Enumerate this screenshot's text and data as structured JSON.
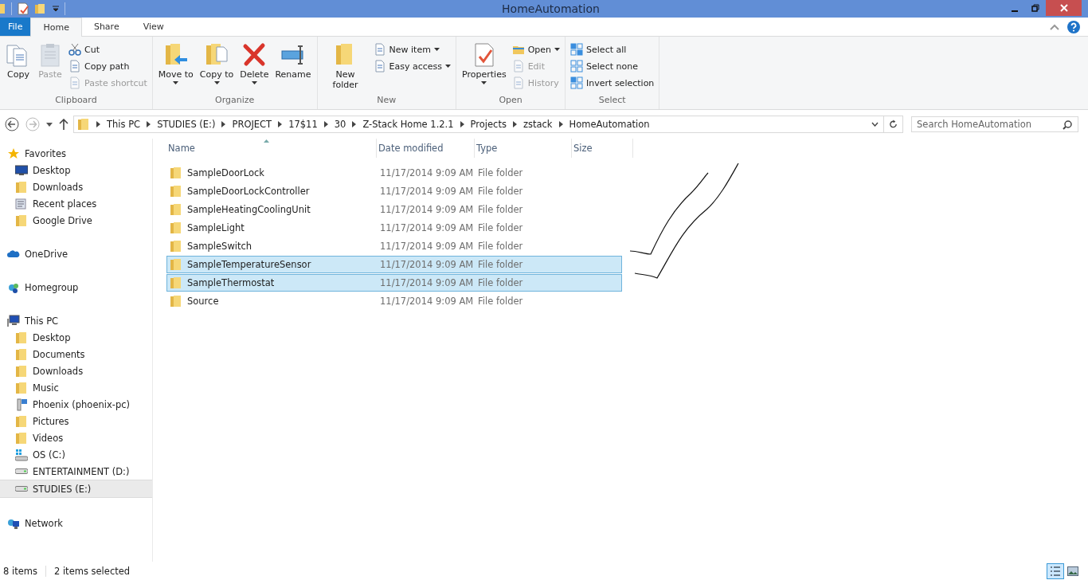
{
  "window": {
    "title": "HomeAutomation"
  },
  "tabs": [
    {
      "label": "File",
      "kind": "file",
      "selected": false
    },
    {
      "label": "Home",
      "kind": "tab",
      "selected": true
    },
    {
      "label": "Share",
      "kind": "tab",
      "selected": false
    },
    {
      "label": "View",
      "kind": "tab",
      "selected": false
    }
  ],
  "ribbon": [
    {
      "label": "Clipboard",
      "buttons": [
        {
          "label": "Copy",
          "kind": "large",
          "disabled": false,
          "dropdown": false
        },
        {
          "label": "Paste",
          "kind": "large",
          "disabled": true,
          "dropdown": false
        },
        {
          "kind": "stack",
          "items": [
            {
              "label": "Cut",
              "disabled": false,
              "dropdown": false
            },
            {
              "label": "Copy path",
              "disabled": false,
              "dropdown": false
            },
            {
              "label": "Paste shortcut",
              "disabled": true,
              "dropdown": false
            }
          ]
        }
      ]
    },
    {
      "label": "Organize",
      "buttons": [
        {
          "label": "Move to",
          "kind": "large",
          "disabled": false,
          "dropdown": true
        },
        {
          "label": "Copy to",
          "kind": "large",
          "disabled": false,
          "dropdown": true
        },
        {
          "label": "Delete",
          "kind": "large",
          "disabled": false,
          "dropdown": true
        },
        {
          "label": "Rename",
          "kind": "large",
          "disabled": false,
          "dropdown": false
        }
      ]
    },
    {
      "label": "New",
      "buttons": [
        {
          "label": "New folder",
          "kind": "large",
          "disabled": false,
          "dropdown": false
        },
        {
          "kind": "stack",
          "items": [
            {
              "label": "New item",
              "disabled": false,
              "dropdown": true
            },
            {
              "label": "Easy access",
              "disabled": false,
              "dropdown": true
            }
          ]
        }
      ]
    },
    {
      "label": "Open",
      "buttons": [
        {
          "label": "Properties",
          "kind": "large",
          "disabled": false,
          "dropdown": true
        },
        {
          "kind": "stack",
          "items": [
            {
              "label": "Open",
              "disabled": false,
              "dropdown": true
            },
            {
              "label": "Edit",
              "disabled": true,
              "dropdown": false
            },
            {
              "label": "History",
              "disabled": true,
              "dropdown": false
            }
          ]
        }
      ]
    },
    {
      "label": "Select",
      "buttons": [
        {
          "kind": "stack",
          "items": [
            {
              "label": "Select all",
              "disabled": false,
              "dropdown": false
            },
            {
              "label": "Select none",
              "disabled": false,
              "dropdown": false
            },
            {
              "label": "Invert selection",
              "disabled": false,
              "dropdown": false
            }
          ]
        }
      ]
    }
  ],
  "address": {
    "path": [
      "This PC",
      "STUDIES (E:)",
      "PROJECT",
      "17$11",
      "30",
      "Z-Stack Home 1.2.1",
      "Projects",
      "zstack",
      "HomeAutomation"
    ]
  },
  "search": {
    "placeholder": "Search HomeAutomation"
  },
  "sidebar": [
    {
      "label": "Favorites",
      "kind": "star",
      "selected": false,
      "children": [
        {
          "label": "Desktop",
          "kind": "desktop",
          "selected": false
        },
        {
          "label": "Downloads",
          "kind": "folder",
          "selected": false
        },
        {
          "label": "Recent places",
          "kind": "recent",
          "selected": false
        },
        {
          "label": "Google Drive",
          "kind": "folder",
          "selected": false
        }
      ]
    },
    {
      "label": "OneDrive",
      "kind": "cloud",
      "selected": false
    },
    {
      "label": "Homegroup",
      "kind": "homegroup",
      "selected": false
    },
    {
      "label": "This PC",
      "kind": "computer",
      "selected": false,
      "children": [
        {
          "label": "Desktop",
          "kind": "folder",
          "selected": false
        },
        {
          "label": "Documents",
          "kind": "folder",
          "selected": false
        },
        {
          "label": "Downloads",
          "kind": "folder",
          "selected": false
        },
        {
          "label": "Music",
          "kind": "folder",
          "selected": false
        },
        {
          "label": "Phoenix (phoenix-pc)",
          "kind": "pc",
          "selected": false
        },
        {
          "label": "Pictures",
          "kind": "folder",
          "selected": false
        },
        {
          "label": "Videos",
          "kind": "folder",
          "selected": false
        },
        {
          "label": "OS (C:)",
          "kind": "windrive",
          "selected": false
        },
        {
          "label": "ENTERTAINMENT (D:)",
          "kind": "drive",
          "selected": false
        },
        {
          "label": "STUDIES (E:)",
          "kind": "drive",
          "selected": true
        }
      ]
    },
    {
      "label": "Network",
      "kind": "network",
      "selected": false
    }
  ],
  "columns": [
    "Name",
    "Date modified",
    "Type",
    "Size"
  ],
  "files": [
    {
      "name": "SampleDoorLock",
      "date": "11/17/2014 9:09 AM",
      "type": "File folder",
      "selected": false
    },
    {
      "name": "SampleDoorLockController",
      "date": "11/17/2014 9:09 AM",
      "type": "File folder",
      "selected": false
    },
    {
      "name": "SampleHeatingCoolingUnit",
      "date": "11/17/2014 9:09 AM",
      "type": "File folder",
      "selected": false
    },
    {
      "name": "SampleLight",
      "date": "11/17/2014 9:09 AM",
      "type": "File folder",
      "selected": false
    },
    {
      "name": "SampleSwitch",
      "date": "11/17/2014 9:09 AM",
      "type": "File folder",
      "selected": false
    },
    {
      "name": "SampleTemperatureSensor",
      "date": "11/17/2014 9:09 AM",
      "type": "File folder",
      "selected": true
    },
    {
      "name": "SampleThermostat",
      "date": "11/17/2014 9:09 AM",
      "type": "File folder",
      "selected": true
    },
    {
      "name": "Source",
      "date": "11/17/2014 9:09 AM",
      "type": "File folder",
      "selected": false
    }
  ],
  "status_bar": {
    "count": "8 items",
    "selection": "2 items selected"
  },
  "views": [
    {
      "kind": "details",
      "selected": true
    },
    {
      "kind": "large-icons",
      "selected": false
    }
  ]
}
